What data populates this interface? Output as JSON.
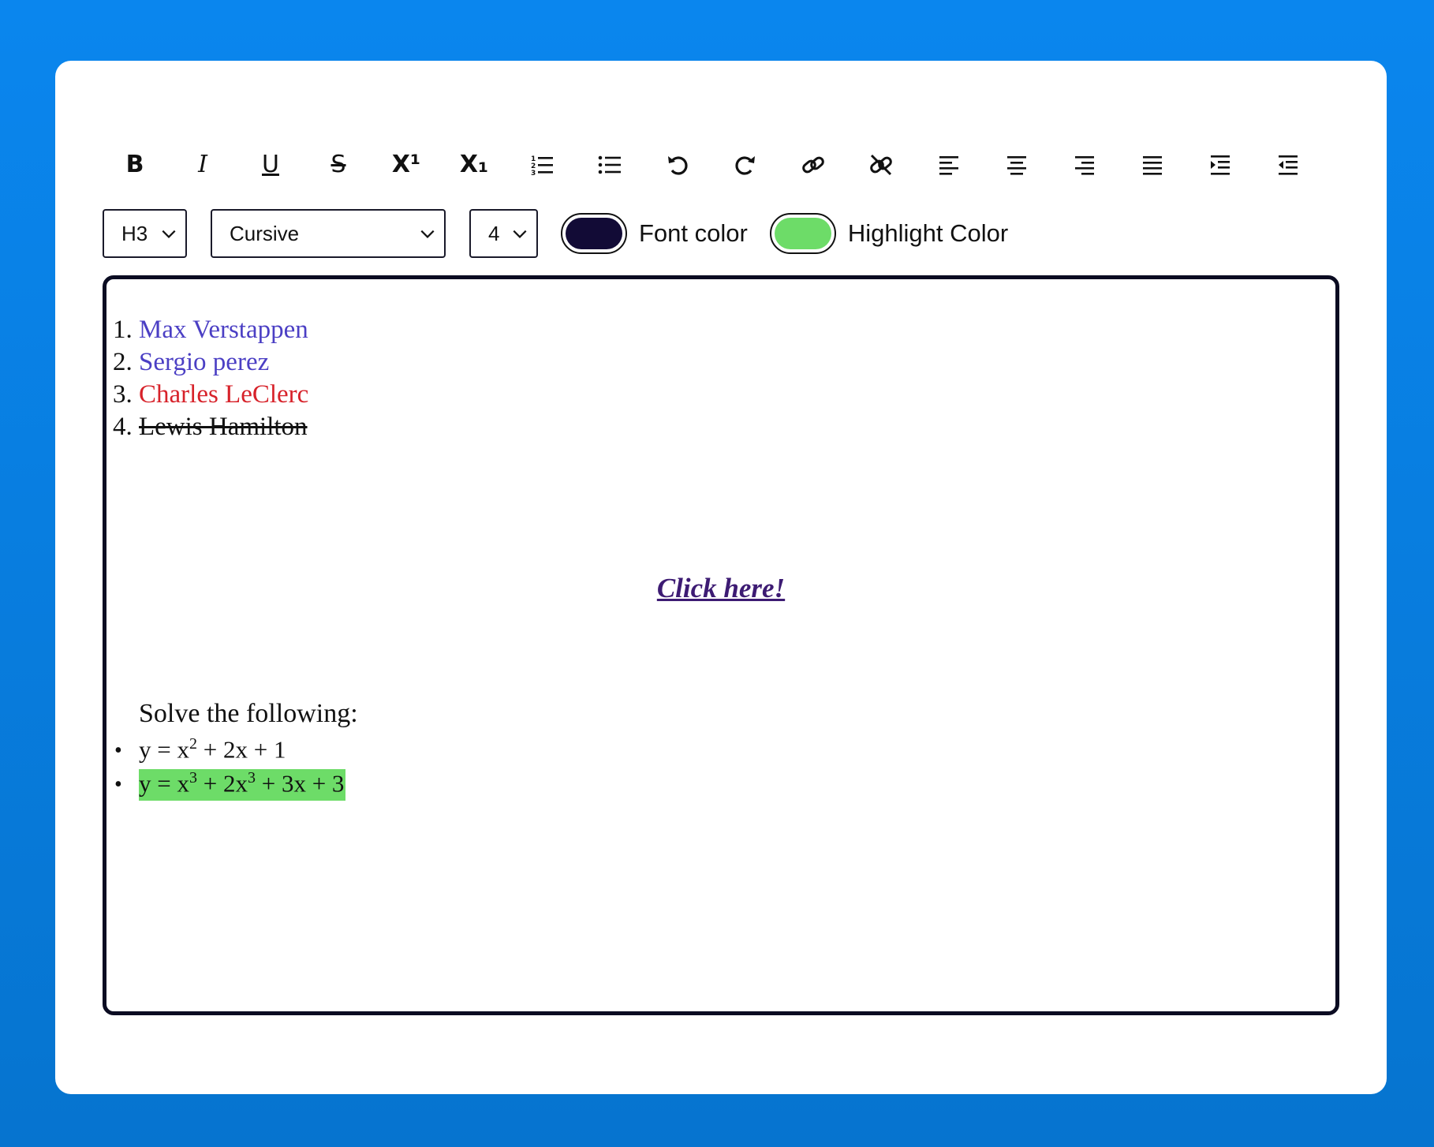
{
  "toolbar": {
    "bold": "B",
    "italic": "I",
    "underline": "U",
    "strike": "S",
    "superscript": "X¹",
    "subscript": "X₁"
  },
  "controls": {
    "heading_value": "H3",
    "font_value": "Cursive",
    "size_value": "4",
    "font_color_label": "Font color",
    "highlight_color_label": "Highlight Color",
    "font_color": "#120b36",
    "highlight_color": "#6ddc68"
  },
  "editor": {
    "ordered_list": [
      {
        "num": "1.",
        "text": "Max Verstappen",
        "color": "#4b3fc4"
      },
      {
        "num": "2.",
        "text": "Sergio perez",
        "color": "#4b3fc4"
      },
      {
        "num": "3.",
        "text": "Charles LeClerc",
        "color": "#d7222a"
      },
      {
        "num": "4.",
        "text": "Lewis Hamilton",
        "color": "#111111"
      }
    ],
    "link_text": "Click here!",
    "link_color": "#3d1b73",
    "solve_text": "Solve the following:",
    "eq1": {
      "pre": "y = x",
      "sup": "2",
      "post": " + 2x + 1"
    },
    "eq2": {
      "pre": "y = x",
      "sup1": "3",
      "mid": " + 2x",
      "sup2": "3",
      "post": " + 3x + 3"
    }
  }
}
